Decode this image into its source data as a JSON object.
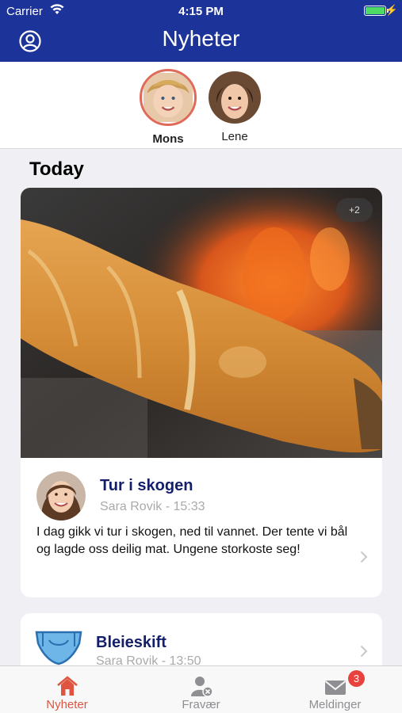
{
  "status_bar": {
    "carrier": "Carrier",
    "time": "4:15 PM",
    "wifi_icon": "wifi-icon",
    "battery_icon": "battery-icon"
  },
  "header": {
    "title": "Nyheter",
    "profile_icon": "profile-icon"
  },
  "children": [
    {
      "name": "Mons",
      "selected": true
    },
    {
      "name": "Lene",
      "selected": false
    }
  ],
  "feed": {
    "section_title": "Today",
    "posts": [
      {
        "more_count": "+2",
        "title": "Tur i skogen",
        "meta": "Sara Rovik - 15:33",
        "body": "I dag gikk vi tur i skogen, ned til vannet. Der tente vi bål og lagde oss deilig mat. Ungene storkoste seg!"
      },
      {
        "icon": "diaper-icon",
        "title": "Bleieskift",
        "meta": "Sara Rovik - 13:50"
      }
    ]
  },
  "tabbar": {
    "tabs": [
      {
        "label": "Nyheter",
        "icon": "home-icon",
        "active": true
      },
      {
        "label": "Fravær",
        "icon": "absence-icon",
        "active": false
      },
      {
        "label": "Meldinger",
        "icon": "envelope-icon",
        "active": false,
        "badge": "3"
      }
    ]
  },
  "colors": {
    "header_bg": "#1c3499",
    "accent": "#e0533f",
    "title_text": "#131f6b",
    "background": "#efeff4"
  }
}
